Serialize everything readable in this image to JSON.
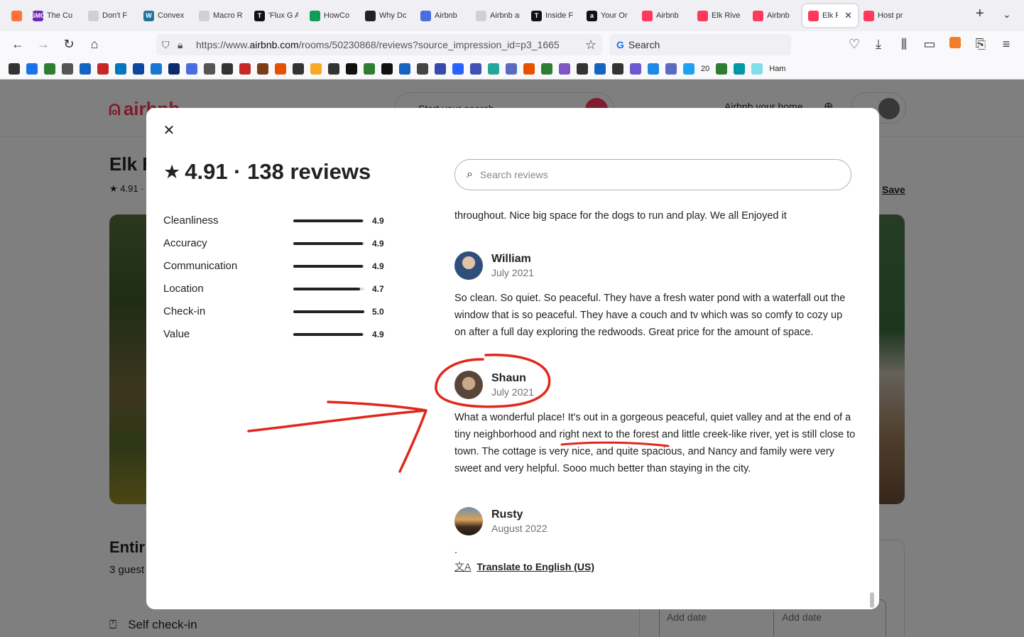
{
  "browser": {
    "tabs": [
      {
        "label": "",
        "icon": "firefox-icon",
        "color": "#ff7139"
      },
      {
        "label": "The Cu",
        "icon": "gmo-icon",
        "color": "#6b2cb0",
        "glyph": "GMO"
      },
      {
        "label": "Don't F",
        "icon": "blank-page-icon",
        "color": "#d0d0d8"
      },
      {
        "label": "Convex",
        "icon": "wordpress-icon",
        "color": "#21759b",
        "glyph": "W"
      },
      {
        "label": "Macro Repc",
        "icon": "blank-page-icon",
        "color": "#d0d0d8"
      },
      {
        "label": "'Flux G AUTOPL",
        "icon": "nyt-icon",
        "color": "#111111",
        "glyph": "T"
      },
      {
        "label": "HowCo",
        "icon": "google-drive-icon",
        "color": "#0f9d58"
      },
      {
        "label": "Why Dc",
        "icon": "dark-circle-icon",
        "color": "#222222"
      },
      {
        "label": "Airbnb",
        "icon": "translate-icon",
        "color": "#4a6ee0"
      },
      {
        "label": "Airbnb and",
        "icon": "blank-page-icon",
        "color": "#d0d0d8"
      },
      {
        "label": "Inside F",
        "icon": "nyt-icon",
        "color": "#111111",
        "glyph": "T"
      },
      {
        "label": "Your Or",
        "icon": "amazon-icon",
        "color": "#111111",
        "glyph": "a"
      },
      {
        "label": "Airbnb",
        "icon": "airbnb-icon",
        "color": "#ff385c"
      },
      {
        "label": "Elk Rive",
        "icon": "airbnb-icon",
        "color": "#ff385c"
      },
      {
        "label": "Airbnb",
        "icon": "airbnb-icon",
        "color": "#ff385c"
      },
      {
        "label": "Elk R",
        "icon": "airbnb-icon",
        "color": "#ff385c",
        "active": true
      },
      {
        "label": "Host pr",
        "icon": "airbnb-icon",
        "color": "#ff385c"
      }
    ],
    "url_prefix": "https://www.",
    "url_domain": "airbnb.com",
    "url_path": "/rooms/50230868/reviews?source_impression_id=p3_1665",
    "search_placeholder": "Search",
    "bookmarks_count_label": "20",
    "bookmarks_last_label": "Ham"
  },
  "page": {
    "logo_text": "airbnb",
    "search_label": "Start your search",
    "host_label": "Airbnb your home",
    "title_partial": "Elk R",
    "rating_partial": "★ 4.91 ·",
    "save_label": "Save",
    "entire_partial": "Entir",
    "guests_partial": "3 guest",
    "checkin_label": "Self check-in",
    "add_date_1": "Add date",
    "add_date_2": "Add date"
  },
  "modal": {
    "summary": "4.91 · 138 reviews",
    "categories": [
      {
        "name": "Cleanliness",
        "value": "4.9",
        "score": 4.9
      },
      {
        "name": "Accuracy",
        "value": "4.9",
        "score": 4.9
      },
      {
        "name": "Communication",
        "value": "4.9",
        "score": 4.9
      },
      {
        "name": "Location",
        "value": "4.7",
        "score": 4.7
      },
      {
        "name": "Check-in",
        "value": "5.0",
        "score": 5.0
      },
      {
        "name": "Value",
        "value": "4.9",
        "score": 4.9
      }
    ],
    "search_placeholder": "Search reviews",
    "partial_review_text": "throughout. Nice big space for the dogs to run and play. We all Enjoyed it",
    "reviews": [
      {
        "name": "William",
        "date": "July 2021",
        "text": "So clean. So quiet. So peaceful. They have a fresh water pond with a waterfall out the window that is so peaceful. They have a couch and tv which was so comfy to cozy up on after a full day exploring the redwoods. Great price for the amount of space.",
        "avatar_color": "#3b5f8a"
      },
      {
        "name": "Shaun",
        "date": "July 2021",
        "text_before": "What a wonderful place! It's out in a gorgeous peaceful, quiet valley and at the end of a tiny neighborhood and ",
        "text_highlight": "right next to the forest",
        "text_after": " and little creek-like river, yet is still close to town. The cottage is very nice, and quite spacious, and Nancy and family were very sweet and very helpful. Sooo much better than staying in the city.",
        "avatar_color": "#5a4638"
      },
      {
        "name": "Rusty",
        "date": "August 2022",
        "text": ".",
        "avatar_color": "#b08040"
      }
    ],
    "translate_label": "Translate to English (US)"
  },
  "annotation_color": "#e0281c"
}
